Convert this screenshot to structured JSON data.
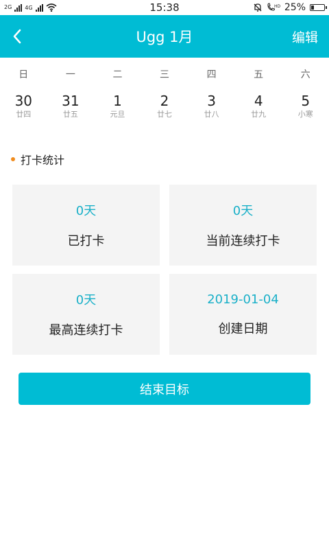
{
  "status_bar": {
    "network_top": "2G",
    "network_bottom": "4G",
    "time": "15:38",
    "battery_text": "25%",
    "battery_level": 0.25,
    "icons": [
      "signal-icon",
      "wifi-icon",
      "bell-mute-icon",
      "hd-call-icon",
      "battery-icon"
    ]
  },
  "app_bar": {
    "title": "Ugg 1月",
    "edit_label": "编辑",
    "background": "#00bcd4"
  },
  "calendar": {
    "weekdays": [
      "日",
      "一",
      "二",
      "三",
      "四",
      "五",
      "六"
    ],
    "dates": [
      {
        "day": "30",
        "lunar": "廿四"
      },
      {
        "day": "31",
        "lunar": "廿五"
      },
      {
        "day": "1",
        "lunar": "元旦"
      },
      {
        "day": "2",
        "lunar": "廿七"
      },
      {
        "day": "3",
        "lunar": "廿八"
      },
      {
        "day": "4",
        "lunar": "廿九"
      },
      {
        "day": "5",
        "lunar": "小寒"
      }
    ]
  },
  "stats": {
    "section_title": "打卡统计",
    "dot_color": "#f08c1e",
    "cards": [
      {
        "value": "0天",
        "label": "已打卡"
      },
      {
        "value": "0天",
        "label": "当前连续打卡"
      },
      {
        "value": "0天",
        "label": "最高连续打卡"
      },
      {
        "value": "2019-01-04",
        "label": "创建日期"
      }
    ]
  },
  "end_button": {
    "label": "结束目标"
  }
}
